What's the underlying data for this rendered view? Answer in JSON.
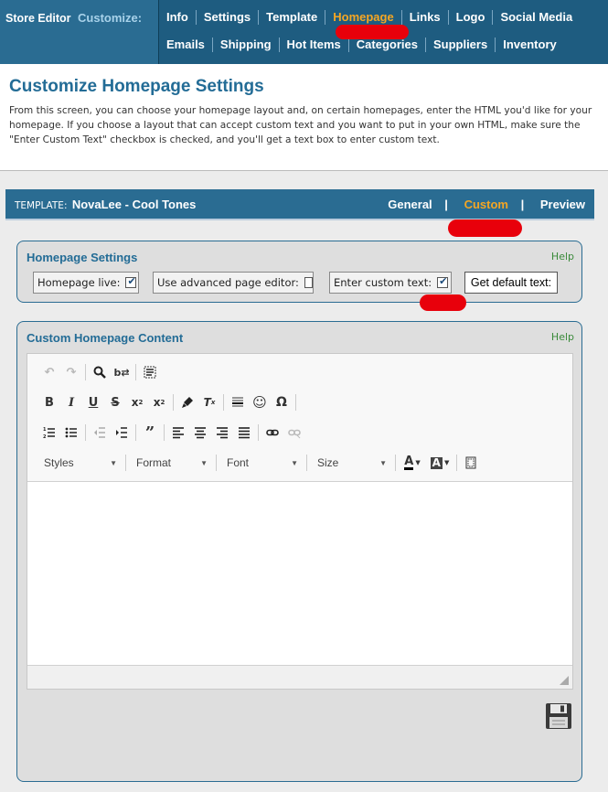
{
  "brand": {
    "title": "Store Editor",
    "customize": "Customize:"
  },
  "nav": {
    "row1": [
      "Info",
      "Settings",
      "Template",
      "Homepage",
      "Links",
      "Logo",
      "Social Media"
    ],
    "row2": [
      "Emails",
      "Shipping",
      "Hot Items",
      "Categories",
      "Suppliers",
      "Inventory"
    ],
    "active": "Homepage"
  },
  "intro": {
    "title": "Customize Homepage Settings",
    "text": "From this screen, you can choose your homepage layout and, on certain homepages, enter the HTML you'd like for your homepage. If you choose a layout that can accept custom text and you want to put in your own HTML, make sure the \"Enter Custom Text\" checkbox is checked, and you'll get a text box to enter custom text."
  },
  "template": {
    "label": "TEMPLATE:",
    "name": "NovaLee - Cool Tones",
    "tabs": [
      "General",
      "Custom",
      "Preview"
    ],
    "separator": "|",
    "active": "Custom"
  },
  "settings": {
    "title": "Homepage Settings",
    "help": "Help",
    "homepage_live": {
      "label": "Homepage live:",
      "checked": true
    },
    "advanced_editor": {
      "label": "Use advanced page editor:",
      "checked": false
    },
    "custom_text": {
      "label": "Enter custom text:",
      "checked": true
    },
    "default_button": "Get default text:"
  },
  "content": {
    "title": "Custom Homepage Content",
    "help": "Help",
    "combos": {
      "styles": "Styles",
      "format": "Format",
      "font": "Font",
      "size": "Size"
    }
  },
  "colors": {
    "nav_bg": "#2a6c92",
    "accent": "#f5a623",
    "annotation_red": "#e8000b",
    "help_green": "#3a8a3a"
  }
}
